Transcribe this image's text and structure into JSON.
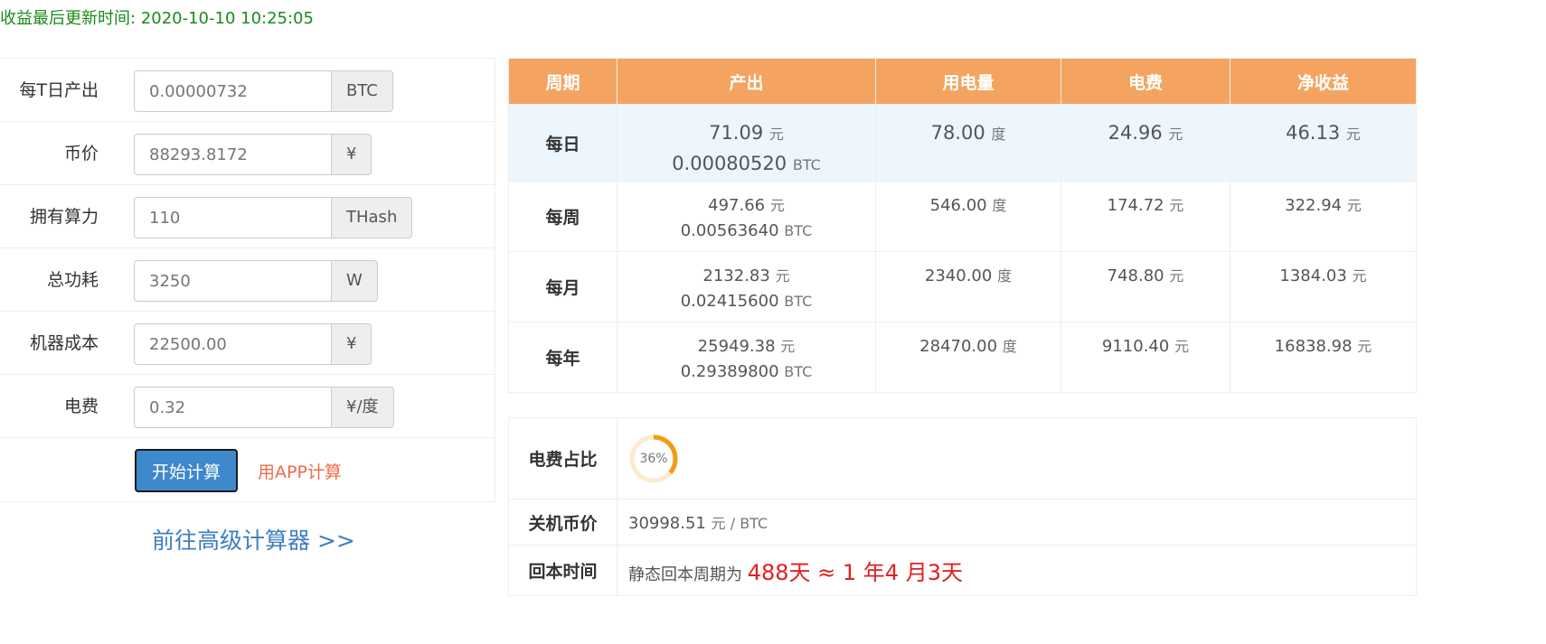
{
  "update_label": "收益最后更新时间: 2020-10-10 10:25:05",
  "form": {
    "rows": [
      {
        "label": "每T日产出",
        "value": "0.00000732",
        "unit": "BTC"
      },
      {
        "label": "币价",
        "value": "88293.8172",
        "unit": "¥"
      },
      {
        "label": "拥有算力",
        "value": "110",
        "unit": "THash"
      },
      {
        "label": "总功耗",
        "value": "3250",
        "unit": "W"
      },
      {
        "label": "机器成本",
        "value": "22500.00",
        "unit": "¥"
      },
      {
        "label": "电费",
        "value": "0.32",
        "unit": "¥/度"
      }
    ],
    "start_button": "开始计算",
    "app_link": "用APP计算",
    "advanced_link": "前往高级计算器 >>"
  },
  "result_table": {
    "headers": [
      "周期",
      "产出",
      "用电量",
      "电费",
      "净收益"
    ],
    "rows": [
      {
        "period": "每日",
        "output_cny": "71.09",
        "output_cny_unit": "元",
        "output_btc": "0.00080520",
        "output_btc_unit": "BTC",
        "power": "78.00",
        "power_unit": "度",
        "fee": "24.96",
        "fee_unit": "元",
        "net": "46.13",
        "net_unit": "元"
      },
      {
        "period": "每周",
        "output_cny": "497.66",
        "output_cny_unit": "元",
        "output_btc": "0.00563640",
        "output_btc_unit": "BTC",
        "power": "546.00",
        "power_unit": "度",
        "fee": "174.72",
        "fee_unit": "元",
        "net": "322.94",
        "net_unit": "元"
      },
      {
        "period": "每月",
        "output_cny": "2132.83",
        "output_cny_unit": "元",
        "output_btc": "0.02415600",
        "output_btc_unit": "BTC",
        "power": "2340.00",
        "power_unit": "度",
        "fee": "748.80",
        "fee_unit": "元",
        "net": "1384.03",
        "net_unit": "元"
      },
      {
        "period": "每年",
        "output_cny": "25949.38",
        "output_cny_unit": "元",
        "output_btc": "0.29389800",
        "output_btc_unit": "BTC",
        "power": "28470.00",
        "power_unit": "度",
        "fee": "9110.40",
        "fee_unit": "元",
        "net": "16838.98",
        "net_unit": "元"
      }
    ]
  },
  "summary": {
    "fee_ratio_label": "电费占比",
    "fee_ratio_text": "36%",
    "fee_ratio_value": 0.36,
    "shutdown_label": "关机币价",
    "shutdown_value": "30998.51",
    "shutdown_unit": "元 / BTC",
    "payback_label": "回本时间",
    "payback_prefix": "静态回本周期为",
    "payback_value": "488天 ≈ 1 年4 月3天"
  },
  "colors": {
    "header_bg": "#f4a460",
    "highlight_row": "#eef6fd",
    "update_text": "#1a8a1a",
    "primary_button": "#3e88cc",
    "app_link": "#ee6a4a",
    "advanced_link": "#3d7fc1",
    "payback": "#e02020",
    "ring_active": "#f39c12",
    "ring_track": "#fdebd0"
  }
}
